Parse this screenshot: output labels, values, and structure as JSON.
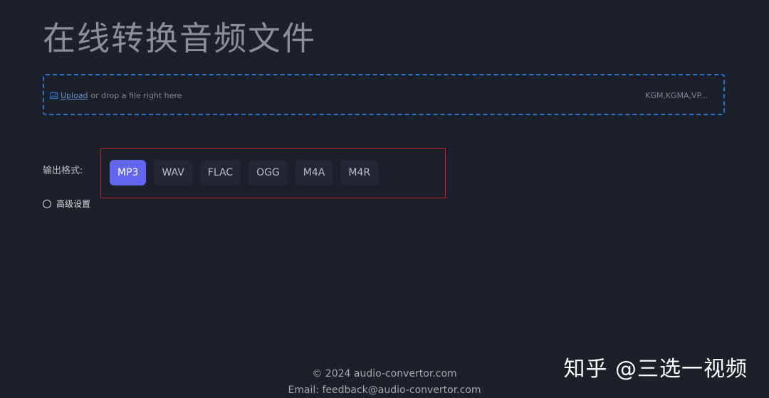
{
  "page": {
    "title": "在线转换音频文件"
  },
  "upload": {
    "icon": "image-upload-icon",
    "link_text": "Upload",
    "drop_text": "or drop a file right here",
    "formats_hint": "KGM,KGMA,VP..."
  },
  "output": {
    "label": "输出格式:",
    "formats": [
      "MP3",
      "WAV",
      "FLAC",
      "OGG",
      "M4A",
      "M4R"
    ],
    "selected": "MP3"
  },
  "advanced": {
    "label": "高级设置"
  },
  "footer": {
    "copyright": "© 2024 audio-convertor.com",
    "email": "Email: feedback@audio-convertor.com"
  },
  "watermark": {
    "text": "知乎 @三选一视频"
  },
  "colors": {
    "accent": "#6366f1",
    "dashed_border": "#2d73c9",
    "highlight_box": "#c81e2a",
    "background": "#1b202a"
  }
}
